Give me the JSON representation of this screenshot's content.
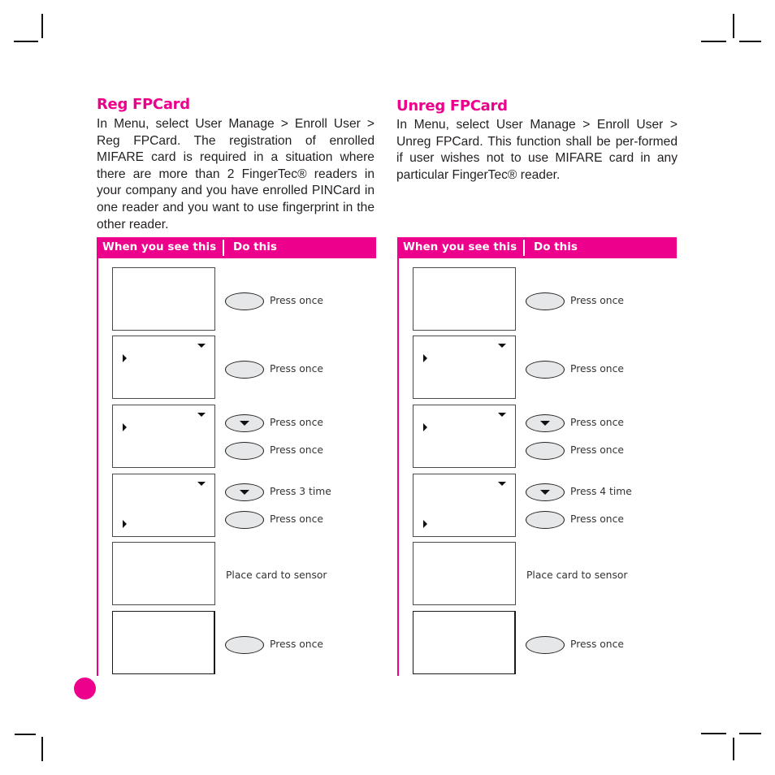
{
  "colors": {
    "accent": "#ec008c",
    "key_fill": "#e6e7e8"
  },
  "left": {
    "title": "Reg FPCard",
    "body": "In Menu, select User Manage > Enroll User > Reg FPCard. The registration of enrolled MIFARE card is required in a situation where there are more than 2 FingerTec® readers in your company and you have enrolled PINCard in one reader and you want to use fingerprint in the other reader.",
    "table": {
      "col1": "When you see this",
      "col2": "Do this",
      "steps": [
        {
          "screen_icons": [],
          "actions": [
            {
              "key": "ok-key",
              "text": "Press once"
            }
          ]
        },
        {
          "screen_icons": [
            "down-mark",
            "cursor-top"
          ],
          "actions": [
            {
              "key": "ok-key",
              "text": "Press once"
            }
          ]
        },
        {
          "screen_icons": [
            "down-mark",
            "cursor-top"
          ],
          "actions": [
            {
              "key": "down-key",
              "text": "Press once"
            },
            {
              "key": "ok-key",
              "text": "Press once"
            }
          ]
        },
        {
          "screen_icons": [
            "down-mark",
            "cursor-bottom"
          ],
          "actions": [
            {
              "key": "down-key",
              "text": "Press 3 time"
            },
            {
              "key": "ok-key",
              "text": "Press once"
            }
          ]
        },
        {
          "screen_icons": [],
          "actions": [
            {
              "key": null,
              "text": "Place card to sensor"
            }
          ]
        },
        {
          "screen_icons": [],
          "actions": [
            {
              "key": "ok-key",
              "text": "Press once"
            }
          ]
        }
      ]
    }
  },
  "right": {
    "title": "Unreg FPCard",
    "body": "In Menu, select User Manage > Enroll User > Unreg FPCard. This function shall be per-formed if user wishes not to use MIFARE card in any particular FingerTec® reader.",
    "table": {
      "col1": "When you see this",
      "col2": "Do this",
      "steps": [
        {
          "screen_icons": [],
          "actions": [
            {
              "key": "ok-key",
              "text": "Press once"
            }
          ]
        },
        {
          "screen_icons": [
            "down-mark",
            "cursor-top"
          ],
          "actions": [
            {
              "key": "ok-key",
              "text": "Press once"
            }
          ]
        },
        {
          "screen_icons": [
            "down-mark",
            "cursor-top"
          ],
          "actions": [
            {
              "key": "down-key",
              "text": "Press once"
            },
            {
              "key": "ok-key",
              "text": "Press once"
            }
          ]
        },
        {
          "screen_icons": [
            "down-mark",
            "cursor-bottom"
          ],
          "actions": [
            {
              "key": "down-key",
              "text": "Press 4 time"
            },
            {
              "key": "ok-key",
              "text": "Press once"
            }
          ]
        },
        {
          "screen_icons": [],
          "actions": [
            {
              "key": null,
              "text": "Place card to sensor"
            }
          ]
        },
        {
          "screen_icons": [],
          "actions": [
            {
              "key": "ok-key",
              "text": "Press once"
            }
          ]
        }
      ]
    }
  }
}
